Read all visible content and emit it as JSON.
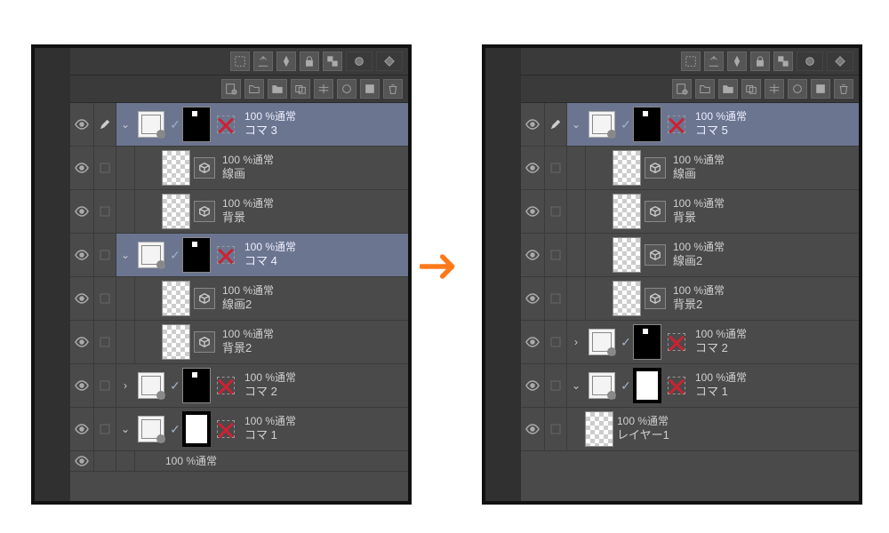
{
  "left": {
    "layers": [
      {
        "kind": "frame",
        "selected": true,
        "expand": "open",
        "thumb": "black",
        "opacity": "100 %通常",
        "name": "コマ 3"
      },
      {
        "kind": "raster",
        "selected": false,
        "indent": 1,
        "thumb": "checker",
        "opacity": "100 %通常",
        "name": "線画",
        "icon": "cube"
      },
      {
        "kind": "raster",
        "selected": false,
        "indent": 1,
        "thumb": "checker",
        "opacity": "100 %通常",
        "name": "背景",
        "icon": "cube"
      },
      {
        "kind": "frame",
        "selected": true,
        "expand": "open",
        "thumb": "black",
        "opacity": "100 %通常",
        "name": "コマ 4"
      },
      {
        "kind": "raster",
        "selected": false,
        "indent": 1,
        "thumb": "checker",
        "opacity": "100 %通常",
        "name": "線画2",
        "icon": "cube"
      },
      {
        "kind": "raster",
        "selected": false,
        "indent": 1,
        "thumb": "checker",
        "opacity": "100 %通常",
        "name": "背景2",
        "icon": "cube"
      },
      {
        "kind": "frame",
        "selected": false,
        "expand": "closed",
        "thumb": "black",
        "opacity": "100 %通常",
        "name": "コマ 2"
      },
      {
        "kind": "frame",
        "selected": false,
        "expand": "open",
        "thumb": "frame-white",
        "opacity": "100 %通常",
        "name": "コマ 1"
      }
    ],
    "cutoff": "100 %通常"
  },
  "right": {
    "layers": [
      {
        "kind": "frame",
        "selected": true,
        "expand": "open",
        "thumb": "black",
        "opacity": "100 %通常",
        "name": "コマ 5"
      },
      {
        "kind": "raster",
        "selected": false,
        "indent": 1,
        "thumb": "checker",
        "opacity": "100 %通常",
        "name": "線画",
        "icon": "cube"
      },
      {
        "kind": "raster",
        "selected": false,
        "indent": 1,
        "thumb": "checker",
        "opacity": "100 %通常",
        "name": "背景",
        "icon": "cube"
      },
      {
        "kind": "raster",
        "selected": false,
        "indent": 1,
        "thumb": "checker",
        "opacity": "100 %通常",
        "name": "線画2",
        "icon": "cube"
      },
      {
        "kind": "raster",
        "selected": false,
        "indent": 1,
        "thumb": "checker",
        "opacity": "100 %通常",
        "name": "背景2",
        "icon": "cube"
      },
      {
        "kind": "frame",
        "selected": false,
        "expand": "closed",
        "thumb": "black",
        "opacity": "100 %通常",
        "name": "コマ 2"
      },
      {
        "kind": "frame",
        "selected": false,
        "expand": "open",
        "thumb": "frame-white",
        "opacity": "100 %通常",
        "name": "コマ 1"
      },
      {
        "kind": "raster",
        "selected": false,
        "indent": 0,
        "thumb": "checker",
        "opacity": "100 %通常",
        "name": "レイヤー1"
      }
    ]
  }
}
